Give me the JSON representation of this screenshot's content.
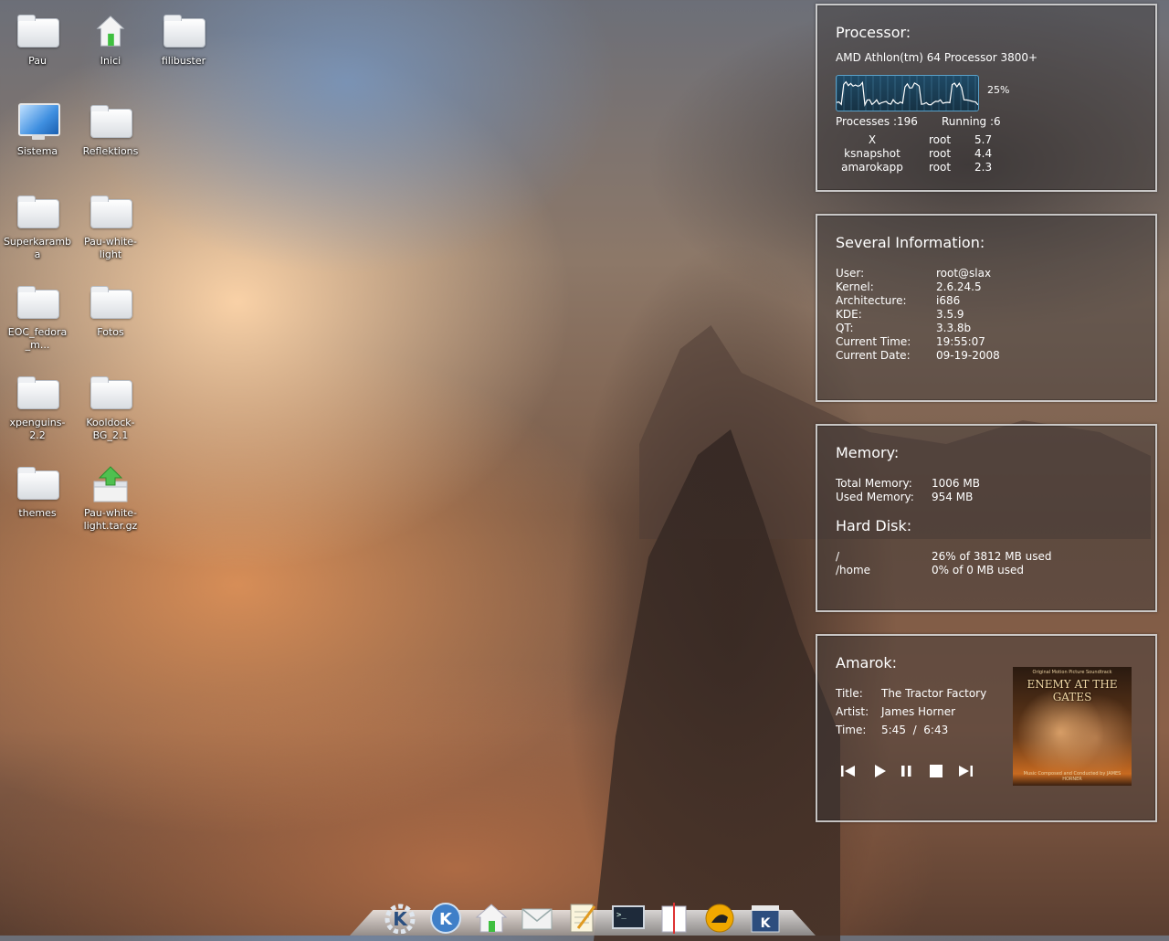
{
  "desktop": {
    "icons": [
      {
        "label": "Pau",
        "kind": "folder-icon"
      },
      {
        "label": "Inici",
        "kind": "home-icon"
      },
      {
        "label": "filibuster",
        "kind": "folder-icon"
      },
      {
        "label": "Sistema",
        "kind": "computer-icon"
      },
      {
        "label": "Reflektions",
        "kind": "folder-icon"
      },
      {
        "label": "Superkaramba",
        "kind": "folder-icon"
      },
      {
        "label": "Pau-white-light",
        "kind": "folder-icon"
      },
      {
        "label": "EOC_fedora_m...",
        "kind": "folder-icon"
      },
      {
        "label": "Fotos",
        "kind": "folder-icon"
      },
      {
        "label": "xpenguins-2.2",
        "kind": "folder-icon"
      },
      {
        "label": "Kooldock-BG_2.1",
        "kind": "folder-icon"
      },
      {
        "label": "themes",
        "kind": "folder-icon"
      },
      {
        "label": "Pau-white-light.tar.gz",
        "kind": "archive-icon"
      }
    ]
  },
  "processor": {
    "title": "Processor:",
    "model": "AMD Athlon(tm) 64 Processor 3800+",
    "load": "25%",
    "processes_label": "Processes :",
    "processes": "196",
    "running_label": "Running :",
    "running": "6",
    "top": [
      {
        "name": "X",
        "user": "root",
        "cpu": "5.7"
      },
      {
        "name": "ksnapshot",
        "user": "root",
        "cpu": "4.4"
      },
      {
        "name": "amarokapp",
        "user": "root",
        "cpu": "2.3"
      }
    ]
  },
  "info": {
    "title": "Several Information:",
    "rows": [
      {
        "label": "User:",
        "value": "root@slax"
      },
      {
        "label": "Kernel:",
        "value": "2.6.24.5"
      },
      {
        "label": "Architecture:",
        "value": "i686"
      },
      {
        "label": "KDE:",
        "value": "3.5.9"
      },
      {
        "label": "QT:",
        "value": "3.3.8b"
      },
      {
        "label": "Current Time:",
        "value": "19:55:07"
      },
      {
        "label": "Current Date:",
        "value": "09-19-2008"
      }
    ]
  },
  "memory": {
    "title": "Memory:",
    "total_label": "Total Memory:",
    "total": "1006 MB",
    "used_label": "Used Memory:",
    "used": "954 MB",
    "disk_title": "Hard Disk:",
    "disks": [
      {
        "mount": "/",
        "usage": "26% of 3812 MB used"
      },
      {
        "mount": "/home",
        "usage": "0% of 0 MB used"
      }
    ]
  },
  "amarok": {
    "title": "Amarok:",
    "title_label": "Title:",
    "track": "The Tractor Factory",
    "artist_label": "Artist:",
    "artist": "James Horner",
    "time_label": "Time:",
    "elapsed": "5:45",
    "sep": "/",
    "total": "6:43",
    "album_title": "ENEMY AT THE GATES",
    "album_sub": "Original Motion Picture Soundtrack",
    "album_credit": "Music Composed and Conducted by JAMES HORNER"
  },
  "dock": {
    "items": [
      "kde-menu-icon",
      "kde-logo-icon",
      "home-icon",
      "mail-icon",
      "text-editor-icon",
      "terminal-icon",
      "notes-icon",
      "update-icon",
      "kde-clapper-icon"
    ]
  },
  "colors": {
    "graph_line": "#ffffff",
    "graph_bg": "#1f4a66",
    "panel_border": "#e6e6e6"
  }
}
